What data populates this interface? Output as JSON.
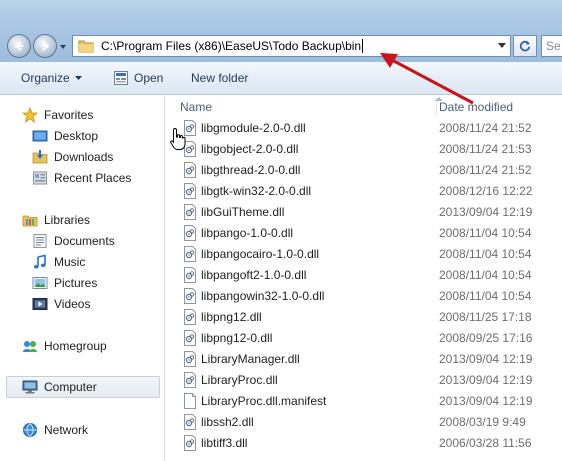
{
  "address": {
    "path": "C:\\Program Files (x86)\\EaseUS\\Todo Backup\\bin",
    "search_text": "Se"
  },
  "toolbar": {
    "organize_label": "Organize",
    "open_label": "Open",
    "new_folder_label": "New folder"
  },
  "sidebar": {
    "favorites": {
      "label": "Favorites",
      "items": [
        "Desktop",
        "Downloads",
        "Recent Places"
      ]
    },
    "libraries": {
      "label": "Libraries",
      "items": [
        "Documents",
        "Music",
        "Pictures",
        "Videos"
      ]
    },
    "homegroup": "Homegroup",
    "computer": "Computer",
    "network": "Network"
  },
  "columns": {
    "name": "Name",
    "date_modified": "Date modified"
  },
  "files": [
    {
      "name": "libgmodule-2.0-0.dll",
      "date": "2008/11/24 21:52",
      "icon": "dll-file-icon"
    },
    {
      "name": "libgobject-2.0-0.dll",
      "date": "2008/11/24 21:53",
      "icon": "dll-file-icon"
    },
    {
      "name": "libgthread-2.0-0.dll",
      "date": "2008/11/24 21:52",
      "icon": "dll-file-icon"
    },
    {
      "name": "libgtk-win32-2.0-0.dll",
      "date": "2008/12/16 12:22",
      "icon": "dll-file-icon"
    },
    {
      "name": "libGuiTheme.dll",
      "date": "2013/09/04 12:19",
      "icon": "dll-file-icon"
    },
    {
      "name": "libpango-1.0-0.dll",
      "date": "2008/11/04 10:54",
      "icon": "dll-file-icon"
    },
    {
      "name": "libpangocairo-1.0-0.dll",
      "date": "2008/11/04 10:54",
      "icon": "dll-file-icon"
    },
    {
      "name": "libpangoft2-1.0-0.dll",
      "date": "2008/11/04 10:54",
      "icon": "dll-file-icon"
    },
    {
      "name": "libpangowin32-1.0-0.dll",
      "date": "2008/11/04 10:54",
      "icon": "dll-file-icon"
    },
    {
      "name": "libpng12.dll",
      "date": "2008/11/25 17:18",
      "icon": "dll-file-icon"
    },
    {
      "name": "libpng12-0.dll",
      "date": "2008/09/25 17:16",
      "icon": "dll-file-icon"
    },
    {
      "name": "LibraryManager.dll",
      "date": "2013/09/04 12:19",
      "icon": "dll-file-icon"
    },
    {
      "name": "LibraryProc.dll",
      "date": "2013/09/04 12:19",
      "icon": "dll-file-icon"
    },
    {
      "name": "LibraryProc.dll.manifest",
      "date": "2013/09/04 12:19",
      "icon": "blank-file-icon"
    },
    {
      "name": "libssh2.dll",
      "date": "2008/03/19 9:49",
      "icon": "dll-file-icon"
    },
    {
      "name": "libtiff3.dll",
      "date": "2006/03/28 11:56",
      "icon": "dll-file-icon"
    }
  ],
  "colors": {
    "annotation_arrow": "#c8141a",
    "address_border": "#6d8db4",
    "header_text": "#4c607a"
  }
}
